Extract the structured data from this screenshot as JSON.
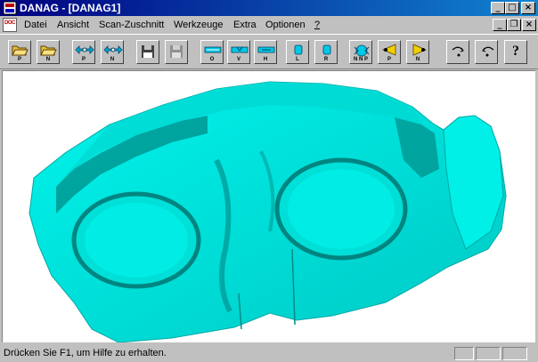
{
  "window": {
    "title": "DANAG - [DANAG1]",
    "controls": {
      "minimize": "_",
      "maximize": "□",
      "close": "×"
    }
  },
  "menu": {
    "items": [
      "Datei",
      "Ansicht",
      "Scan-Zuschnitt",
      "Werkzeuge",
      "Extra",
      "Optionen",
      "?"
    ],
    "doc_icon_text": "DOC",
    "mdi_controls": {
      "minimize": "_",
      "restore": "❐",
      "close": "×"
    }
  },
  "toolbar": {
    "buttons": [
      {
        "icon": "folder-open-p-icon",
        "label": "P"
      },
      {
        "icon": "folder-open-n-icon",
        "label": "N"
      },
      {
        "icon": "arrows-p-icon",
        "label": "P"
      },
      {
        "icon": "arrows-n-icon",
        "label": "N"
      },
      {
        "icon": "floppy-save-icon",
        "label": ""
      },
      {
        "icon": "save-disabled-icon",
        "label": ""
      },
      {
        "icon": "cut-o-icon",
        "label": "O"
      },
      {
        "icon": "cut-v-icon",
        "label": "V"
      },
      {
        "icon": "cut-h-icon",
        "label": "H"
      },
      {
        "icon": "cut-l-icon",
        "label": "L"
      },
      {
        "icon": "cut-r-icon",
        "label": "R"
      },
      {
        "icon": "scan-combine-icon",
        "label": "N N P"
      },
      {
        "icon": "light-p-icon",
        "label": "P"
      },
      {
        "icon": "light-n-icon",
        "label": "N"
      },
      {
        "icon": "rotate-right-icon",
        "label": ""
      },
      {
        "icon": "rotate-left-icon",
        "label": ""
      },
      {
        "icon": "help-icon",
        "label": "?"
      }
    ]
  },
  "status": {
    "text": "Drücken Sie F1, um Hilfe zu erhalten."
  },
  "colors": {
    "title_start": "#000080",
    "title_end": "#1084d0",
    "scan_surface": "#00e8e0",
    "scan_shadow": "#008c88"
  }
}
